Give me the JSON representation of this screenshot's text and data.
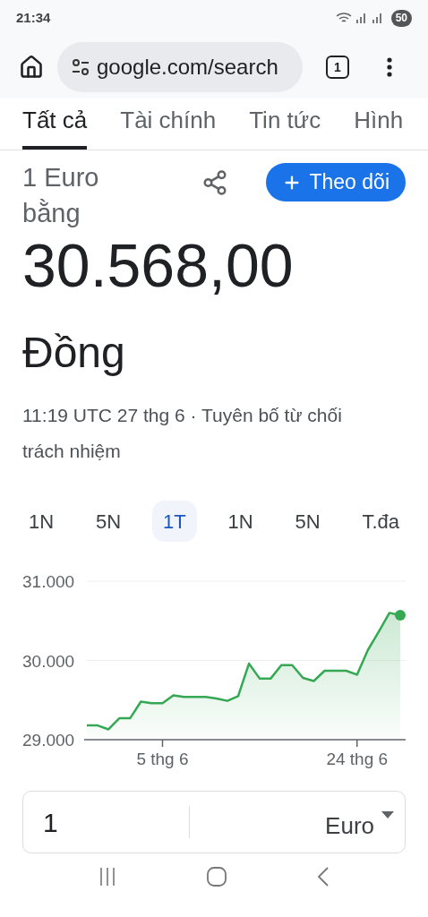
{
  "status_bar": {
    "time": "21:34",
    "battery": "50"
  },
  "browser": {
    "url": "google.com/search",
    "tab_count": "1"
  },
  "tabs": [
    {
      "label": "Tất cả",
      "selected": true
    },
    {
      "label": "Tài chính",
      "selected": false
    },
    {
      "label": "Tin tức",
      "selected": false
    },
    {
      "label": "Hình",
      "selected": false
    }
  ],
  "result": {
    "from_label": "1 Euro\nbằng",
    "value": "30.568,00",
    "currency": "Đồng",
    "follow_button": "Theo dõi",
    "timestamp": "11:19 UTC 27 thg 6 · Tuyên bố từ chối trách nhiệm"
  },
  "ranges": [
    {
      "label": "1N",
      "selected": false
    },
    {
      "label": "5N",
      "selected": false
    },
    {
      "label": "1T",
      "selected": true
    },
    {
      "label": "1N",
      "selected": false
    },
    {
      "label": "5N",
      "selected": false
    },
    {
      "label": "T.đa",
      "selected": false
    }
  ],
  "chart": {
    "chart_data": {
      "type": "area",
      "categories": [
        null,
        null,
        null,
        null,
        null,
        null,
        null,
        "5 thg 6",
        null,
        null,
        null,
        null,
        null,
        null,
        null,
        null,
        null,
        null,
        null,
        null,
        null,
        null,
        null,
        null,
        null,
        "24 thg 6",
        null,
        null,
        null,
        null
      ],
      "series": [
        {
          "color": "#34a853",
          "values": [
            29180,
            29180,
            29130,
            29270,
            29270,
            29480,
            29460,
            29460,
            29560,
            29540,
            29540,
            29540,
            29520,
            29490,
            29550,
            29960,
            29770,
            29770,
            29940,
            29940,
            29780,
            29740,
            29870,
            29870,
            29870,
            29820,
            30130,
            30360,
            30600,
            30570
          ]
        }
      ],
      "ylim": [
        29000,
        31000
      ],
      "yticks": [
        {
          "value": 29000,
          "label": "29.000"
        },
        {
          "value": 30000,
          "label": "30.000"
        },
        {
          "value": 31000,
          "label": "31.000"
        }
      ]
    }
  },
  "converter": {
    "amount": "1",
    "currency": "Euro"
  }
}
